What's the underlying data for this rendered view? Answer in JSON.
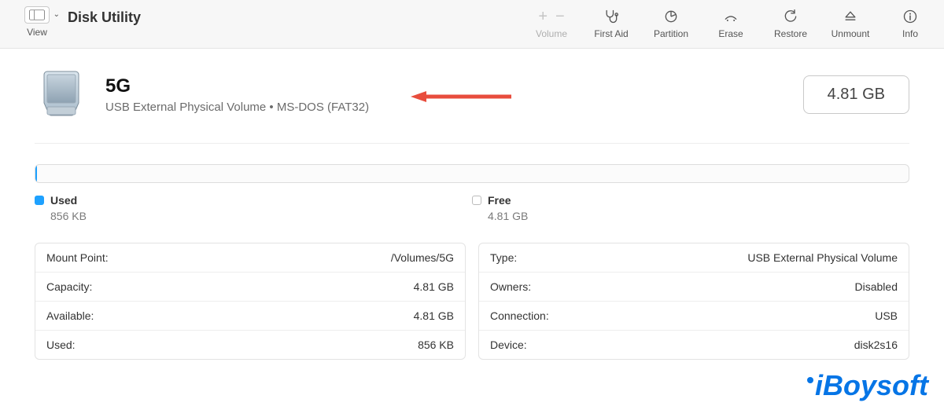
{
  "toolbar": {
    "view_label": "View",
    "app_title": "Disk Utility",
    "volume_label": "Volume",
    "actions": {
      "first_aid": "First Aid",
      "partition": "Partition",
      "erase": "Erase",
      "restore": "Restore",
      "unmount": "Unmount",
      "info": "Info"
    }
  },
  "header": {
    "title": "5G",
    "subtitle": "USB External Physical Volume • MS-DOS (FAT32)",
    "size": "4.81 GB"
  },
  "usage": {
    "used_label": "Used",
    "used_value": "856 KB",
    "free_label": "Free",
    "free_value": "4.81 GB"
  },
  "info_left": [
    {
      "k": "Mount Point:",
      "v": "/Volumes/5G"
    },
    {
      "k": "Capacity:",
      "v": "4.81 GB"
    },
    {
      "k": "Available:",
      "v": "4.81 GB"
    },
    {
      "k": "Used:",
      "v": "856 KB"
    }
  ],
  "info_right": [
    {
      "k": "Type:",
      "v": "USB External Physical Volume"
    },
    {
      "k": "Owners:",
      "v": "Disabled"
    },
    {
      "k": "Connection:",
      "v": "USB"
    },
    {
      "k": "Device:",
      "v": "disk2s16"
    }
  ],
  "watermark": "iBoysoft"
}
